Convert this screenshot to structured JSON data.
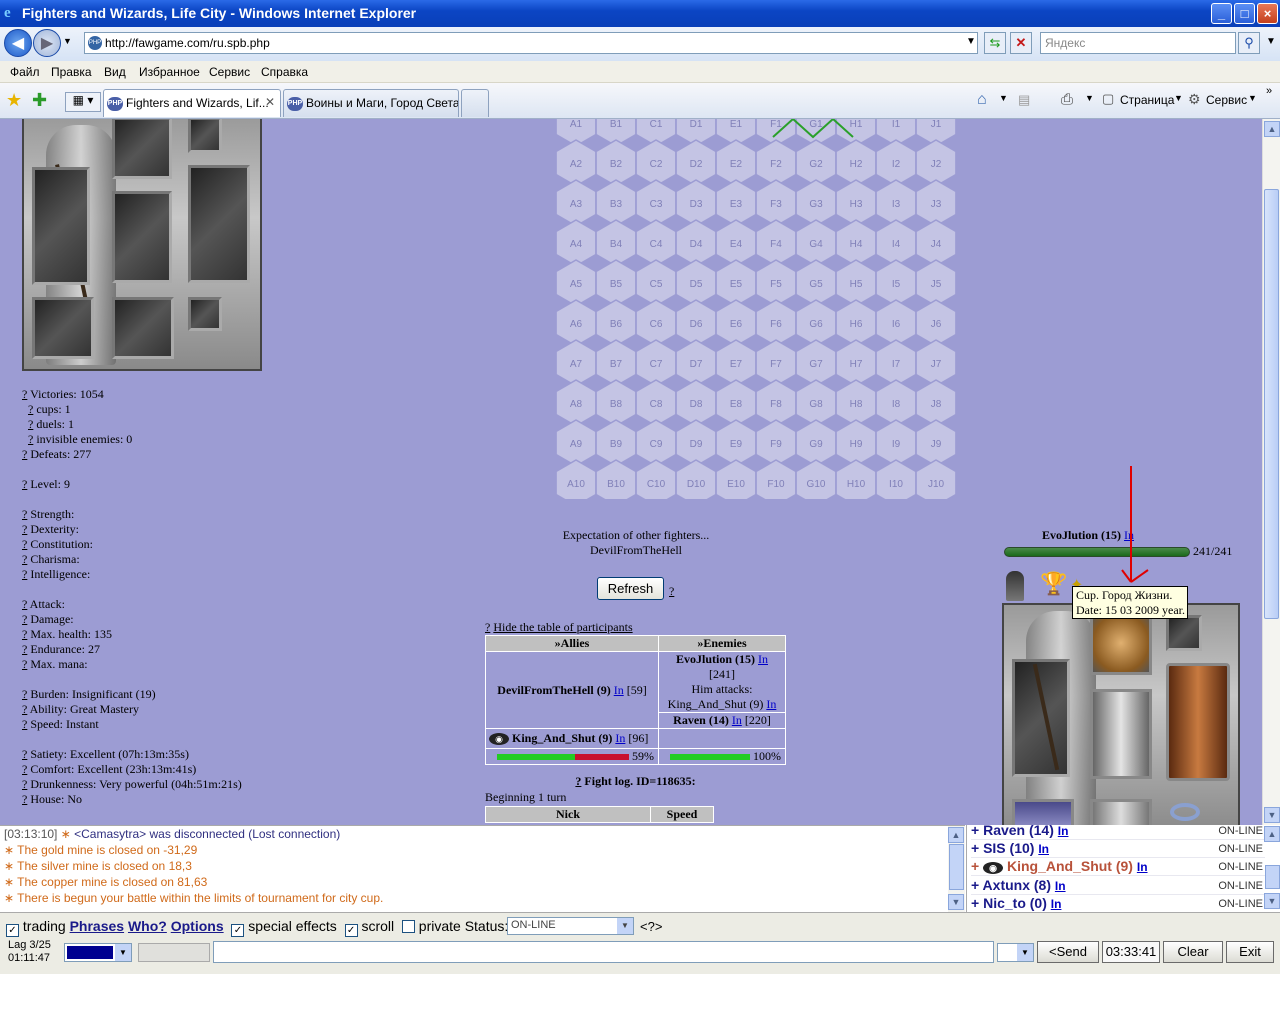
{
  "window": {
    "title": "Fighters and Wizards, Life City - Windows Internet Explorer",
    "minimize": "_",
    "maximize": "□",
    "close": "×"
  },
  "address": {
    "url": "http://fawgame.com/ru.spb.php",
    "search_placeholder": "Яндекс"
  },
  "menu": [
    "Файл",
    "Правка",
    "Вид",
    "Избранное",
    "Сервис",
    "Справка"
  ],
  "tabs": [
    {
      "label": "Fighters and Wizards, Lif...",
      "active": true
    },
    {
      "label": "Воины и Маги, Город Света",
      "active": false
    }
  ],
  "toolbar": {
    "page_label": "Страница",
    "tools_label": "Сервис"
  },
  "stats": {
    "victories": "Victories: 1054",
    "cups": "cups: 1",
    "duels": "duels: 1",
    "invisible": "invisible enemies: 0",
    "defeats": "Defeats: 277",
    "level": "Level: 9",
    "strength": "Strength:",
    "dexterity": "Dexterity:",
    "constitution": "Constitution:",
    "charisma": "Charisma:",
    "intelligence": "Intelligence:",
    "attack": "Attack:",
    "damage": "Damage:",
    "max_health": "Max. health: 135",
    "endurance": "Endurance: 27",
    "max_mana": "Max. mana:",
    "burden": "Burden: Insignificant (19)",
    "ability": "Ability: Great Mastery",
    "speed": "Speed: Instant",
    "satiety": "Satiety: Excellent (07h:13m:35s)",
    "comfort": "Comfort: Excellent (23h:13m:41s)",
    "drunkenness": "Drunkenness: Very powerful (04h:51m:21s)",
    "house": "House: No",
    "q": "?"
  },
  "hex": {
    "cols": [
      "A",
      "B",
      "C",
      "D",
      "E",
      "F",
      "G",
      "H",
      "I",
      "J"
    ],
    "rows": [
      1,
      2,
      3,
      4,
      5,
      6,
      7,
      8,
      9,
      10
    ]
  },
  "battle": {
    "expectation": "Expectation of other fighters...",
    "fighter": "DevilFromTheHell",
    "refresh": "Refresh",
    "q": "?",
    "hide_table": "Hide the table of participants",
    "allies_header": "»Allies",
    "enemies_header": "»Enemies",
    "ally1_name": "DevilFromTheHell (9)",
    "ally1_hp": "[59]",
    "enemy1_name": "EvoJlution (15)",
    "enemy1_hp": "[241]",
    "him_attacks": "Him attacks:",
    "attacks_target": "King_And_Shut (9)",
    "enemy2_name": "Raven (14)",
    "enemy2_hp": "[220]",
    "ally2_name": "King_And_Shut (9)",
    "ally2_hp": "[96]",
    "ally2_pct": "59%",
    "ally2_fill": 59,
    "enemy2_pct": "100%",
    "enemy2_fill": 100,
    "in": "In",
    "fight_log": "Fight log. ID=118635:",
    "beginning": "Beginning 1 turn",
    "col_nick": "Nick",
    "col_speed": "Speed"
  },
  "opponent": {
    "name": "EvoJlution (15)",
    "in": "In",
    "hp": "241/241",
    "tooltip1": "Cup. Город Жизни.",
    "tooltip2": "Date: 15 03 2009 year."
  },
  "chat": [
    {
      "time": "[03:13:10]",
      "text": "<Camasytra> was disconnected (Lost connection)",
      "color": "#303080"
    },
    {
      "time": "",
      "text": "The gold mine is closed on -31,29",
      "color": "#d06a1a"
    },
    {
      "time": "",
      "text": "The silver mine is closed on 18,3",
      "color": "#d06a1a"
    },
    {
      "time": "",
      "text": "The copper mine is closed on 81,63",
      "color": "#d06a1a"
    },
    {
      "time": "",
      "text": "There is begun your battle within the limits of tournament for city cup.",
      "color": "#d06a1a"
    }
  ],
  "users": [
    {
      "name": "Raven (14)",
      "in": "In",
      "status": "ON-LINE"
    },
    {
      "name": "SIS (10)",
      "in": "In",
      "status": "ON-LINE"
    },
    {
      "name": "King_And_Shut (9)",
      "in": "In",
      "status": "ON-LINE"
    },
    {
      "name": "Axtunx (8)",
      "in": "In",
      "status": "ON-LINE"
    },
    {
      "name": "Nic_to (0)",
      "in": "In",
      "status": "ON-LINE"
    }
  ],
  "controls": {
    "trading": "trading",
    "phrases": "Phrases",
    "who": "Who?",
    "options": "Options",
    "special_effects": "special effects",
    "scroll": "scroll",
    "private": "private",
    "status_label": "Status:",
    "status_value": "ON-LINE",
    "help": "<?>",
    "lag": "Lag 3/25",
    "time": "01:11:47",
    "send": "<Send",
    "clock": "03:33:41",
    "clear": "Clear",
    "exit": "Exit"
  }
}
